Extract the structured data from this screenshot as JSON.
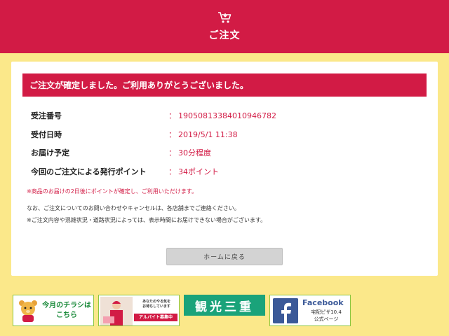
{
  "header": {
    "cart_icon": "cart-icon",
    "title": "ご注文"
  },
  "confirmation": {
    "message": "ご注文が確定しました。ご利用ありがとうございました。"
  },
  "details": [
    {
      "label": "受注番号",
      "value": "19050813384010946782"
    },
    {
      "label": "受付日時",
      "value": "2019/5/1 11:38"
    },
    {
      "label": "お届け予定",
      "value": "30分程度"
    },
    {
      "label": "今回のご注文による発行ポイント",
      "value": "34ポイント"
    }
  ],
  "separator": "：",
  "notes": {
    "points_note": "※商品のお届けの2日後にポイントが確定し、ご利用いただけます。",
    "contact_note": "なお、ご注文についてのお問い合わせやキャンセルは、各店舗までご連絡ください。",
    "delivery_note": "※ご注文内容や混雑状況・道路状況によっては、表示時間にお届けできない場合がございます。"
  },
  "home_button": "ホームに戻る",
  "banners": {
    "flyer": "今月のチラシは\nこちら",
    "job_small": "あなたのやる気を\nお待ちしています",
    "job_recruit": "アルバイト募集中",
    "kanko": "観光三重",
    "facebook_title": "Facebook",
    "facebook_sub": "宅配ピザ10.4\n公式ページ"
  },
  "colors": {
    "accent": "#d21b45",
    "background": "#fbe88a",
    "facebook": "#3b5998",
    "kanko": "#1aa37a"
  }
}
